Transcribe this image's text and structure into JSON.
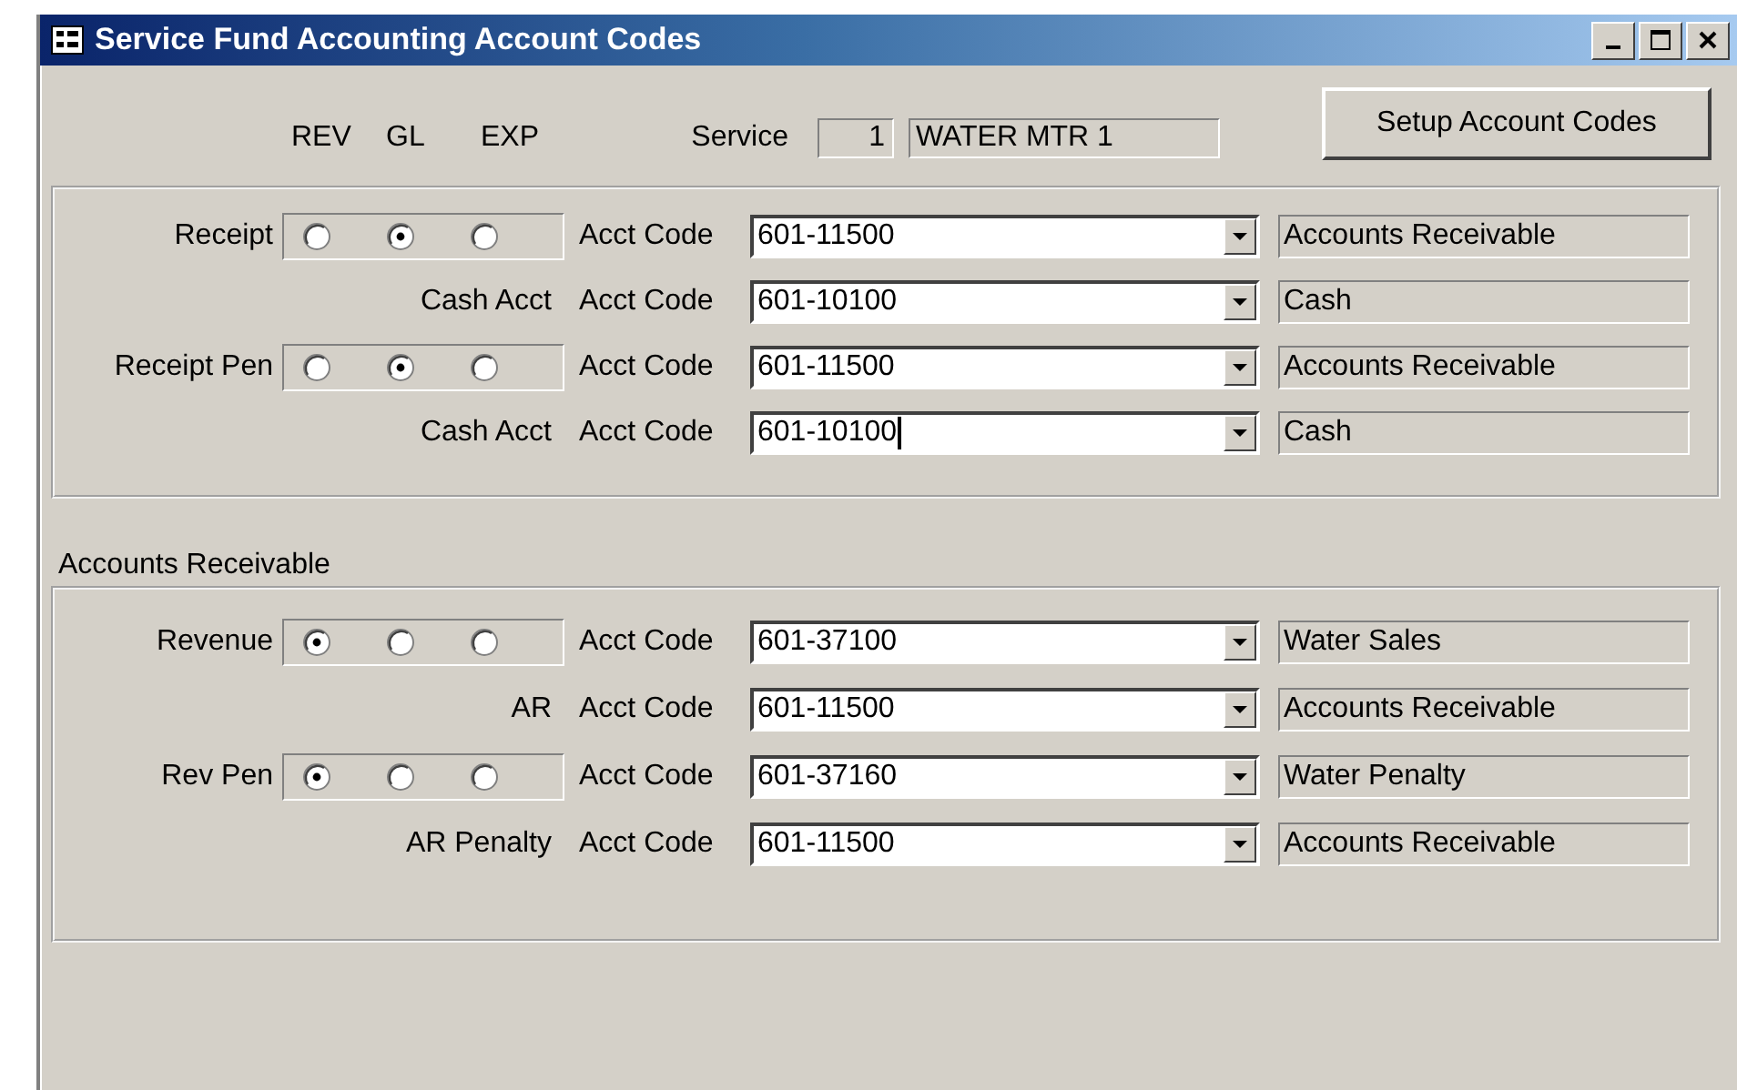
{
  "window": {
    "title": "Service Fund Accounting Account Codes"
  },
  "header": {
    "radio_labels": [
      "REV",
      "GL",
      "EXP"
    ],
    "service_label": "Service",
    "service_number": "1",
    "service_name": "WATER MTR 1",
    "setup_button": "Setup Account  Codes"
  },
  "groups": [
    {
      "rows": [
        {
          "kind": "radio",
          "label": "Receipt",
          "options": [
            {
              "selected": false
            },
            {
              "selected": true
            },
            {
              "selected": false
            }
          ],
          "code_label": "Acct Code",
          "code": "601-11500",
          "description": "Accounts Receivable",
          "focused": false
        },
        {
          "kind": "plain",
          "label": "Cash Acct",
          "code_label": "Acct Code",
          "code": "601-10100",
          "description": "Cash",
          "focused": false
        },
        {
          "kind": "radio",
          "label": "Receipt Pen",
          "options": [
            {
              "selected": false
            },
            {
              "selected": true
            },
            {
              "selected": false
            }
          ],
          "code_label": "Acct Code",
          "code": "601-11500",
          "description": "Accounts Receivable",
          "focused": false
        },
        {
          "kind": "plain",
          "label": "Cash Acct",
          "code_label": "Acct Code",
          "code": "601-10100",
          "description": "Cash",
          "focused": true
        }
      ]
    },
    {
      "title": "Accounts Receivable",
      "rows": [
        {
          "kind": "radio",
          "label": "Revenue",
          "options": [
            {
              "selected": true
            },
            {
              "selected": false
            },
            {
              "selected": false
            }
          ],
          "code_label": "Acct Code",
          "code": "601-37100",
          "description": "Water Sales",
          "focused": false
        },
        {
          "kind": "plain",
          "label": "AR",
          "code_label": "Acct Code",
          "code": "601-11500",
          "description": "Accounts Receivable",
          "focused": false
        },
        {
          "kind": "radio",
          "label": "Rev Pen",
          "options": [
            {
              "selected": true
            },
            {
              "selected": false
            },
            {
              "selected": false
            }
          ],
          "code_label": "Acct Code",
          "code": "601-37160",
          "description": "Water Penalty",
          "focused": false
        },
        {
          "kind": "plain",
          "label": "AR Penalty",
          "code_label": "Acct Code",
          "code": "601-11500",
          "description": "Accounts Receivable",
          "focused": false
        }
      ]
    }
  ]
}
